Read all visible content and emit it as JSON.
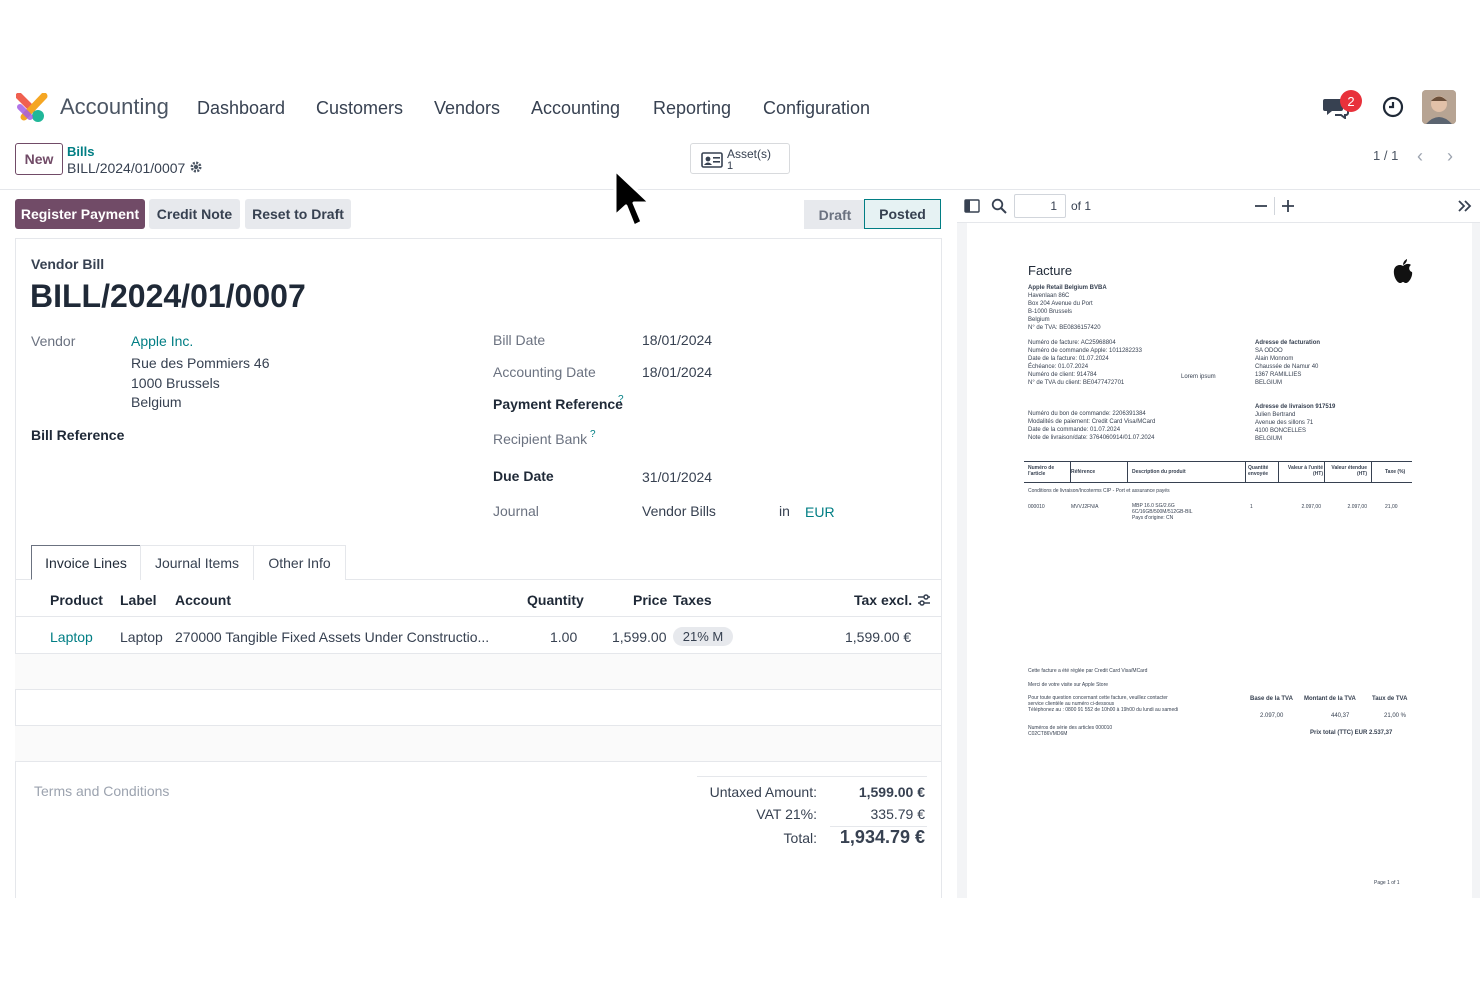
{
  "app": {
    "name": "Accounting"
  },
  "nav": [
    "Dashboard",
    "Customers",
    "Vendors",
    "Accounting",
    "Reporting",
    "Configuration"
  ],
  "notifications": {
    "count": "2"
  },
  "control": {
    "new_label": "New",
    "breadcrumb_parent": "Bills",
    "breadcrumb_current": "BILL/2024/01/0007",
    "asset_label": "Asset(s)",
    "asset_count": "1",
    "pager": "1 / 1"
  },
  "actions": {
    "register_payment": "Register Payment",
    "credit_note": "Credit Note",
    "reset_to_draft": "Reset to Draft"
  },
  "status": {
    "draft": "Draft",
    "posted": "Posted"
  },
  "form": {
    "doc_type": "Vendor Bill",
    "doc_number": "BILL/2024/01/0007",
    "vendor_label": "Vendor",
    "vendor_name": "Apple Inc.",
    "vendor_address": [
      "Rue des Pommiers 46",
      "1000 Brussels",
      "Belgium"
    ],
    "bill_reference_label": "Bill Reference",
    "bill_date_label": "Bill Date",
    "bill_date": "18/01/2024",
    "accounting_date_label": "Accounting Date",
    "accounting_date": "18/01/2024",
    "payment_reference_label": "Payment Reference",
    "recipient_bank_label": "Recipient Bank",
    "help_mark": "?",
    "due_date_label": "Due Date",
    "due_date": "31/01/2024",
    "journal_label": "Journal",
    "journal": "Vendor Bills",
    "in_label": "in",
    "currency": "EUR"
  },
  "tabs": [
    "Invoice Lines",
    "Journal Items",
    "Other Info"
  ],
  "lines": {
    "headers": {
      "product": "Product",
      "label": "Label",
      "account": "Account",
      "quantity": "Quantity",
      "price": "Price",
      "taxes": "Taxes",
      "tax_excl": "Tax excl."
    },
    "rows": [
      {
        "product": "Laptop",
        "label": "Laptop",
        "account": "270000 Tangible Fixed Assets Under Constructio...",
        "quantity": "1.00",
        "price": "1,599.00",
        "tax": "21% M",
        "subtotal": "1,599.00 €"
      }
    ]
  },
  "terms_placeholder": "Terms and Conditions",
  "totals": {
    "untaxed_label": "Untaxed Amount:",
    "untaxed": "1,599.00 €",
    "vat_label": "VAT 21%:",
    "vat": "335.79 €",
    "total_label": "Total:",
    "total": "1,934.79 €"
  },
  "pdf": {
    "page_input": "1",
    "of_label": "of 1",
    "title": "Facture",
    "sender": [
      "Apple Retail Belgium BVBA",
      "Havenlaan 86C",
      "Box 204 Avenue du Port",
      "B-1000 Brussels",
      "Belgium",
      "N° de TVA: BE0836157420"
    ],
    "invoice_info": [
      "Numéro de facture:  AC25968804",
      "Numéro de commande Apple:  1011282233",
      "Date de la facture:  01.07.2024",
      "Échéance:  01.07.2024",
      "Numéro de client:  914784",
      "N° de TVA du client:  BE0477472701"
    ],
    "lorem": "Lorem ipsum",
    "billing_title": "Adresse de facturation",
    "billing": [
      "SA ODOO",
      "Alain Monnom",
      "Chaussée de Namur 40",
      "1367 RAMILLIES",
      "BELGIUM"
    ],
    "delivery_title": "Adresse de livraison 917519",
    "delivery": [
      "Julien Bertrand",
      "Avenue des sillons 71",
      "4100 BONCELLES",
      "BELGIUM"
    ],
    "order_info": [
      "Numéro du bon de commande:  2206391384",
      "Modalités de paiement:  Credit Card Visa/MCard",
      "Date de la commande:  01.07.2024",
      "Note de livraison/date:  3764060914/01.07.2024"
    ],
    "table_headers": [
      "Numéro de l'article",
      "Référence",
      "Description du produit",
      "Quantité envoyée",
      "Valeur à l'unité (HT)",
      "Valeur étendue (HT)",
      "Taxe (%)"
    ],
    "conditions": "Conditions de livraison/Incoterms CIP - Port et assurance payés",
    "item": {
      "number": "000010",
      "ref": "MVVJ2FN/A",
      "desc": [
        "MBP 16.0 SG/2.6G",
        "6C/16GB/500M/512GB-BIL",
        "Pays d'origine: CN"
      ],
      "qty": "1",
      "unit": "2.097,00",
      "ext": "2.097,00",
      "tax": "21,00"
    },
    "footer_notes": [
      "Cette facture a été réglée par Credit Card Visa/MCard",
      "Merci de votre visite sur Apple Store",
      "Pour toute question concernant cette facture, veuillez contacter",
      "service clientèle au numéro ci-dessous",
      "Téléphonez au : 0800 91 552 de 10h00 à 19h00 du lundi au samedi",
      "Numéros de série des articles 000010",
      "C02CT86VMD6M"
    ],
    "vat_headers": [
      "Base de la TVA",
      "Montant de la TVA",
      "Taux de TVA"
    ],
    "vat_values": [
      "2.097,00",
      "440,37",
      "21,00 %"
    ],
    "total_line": "Prix total (TTC)   EUR  2.537,37",
    "page_footer": "Page 1 of 1"
  }
}
